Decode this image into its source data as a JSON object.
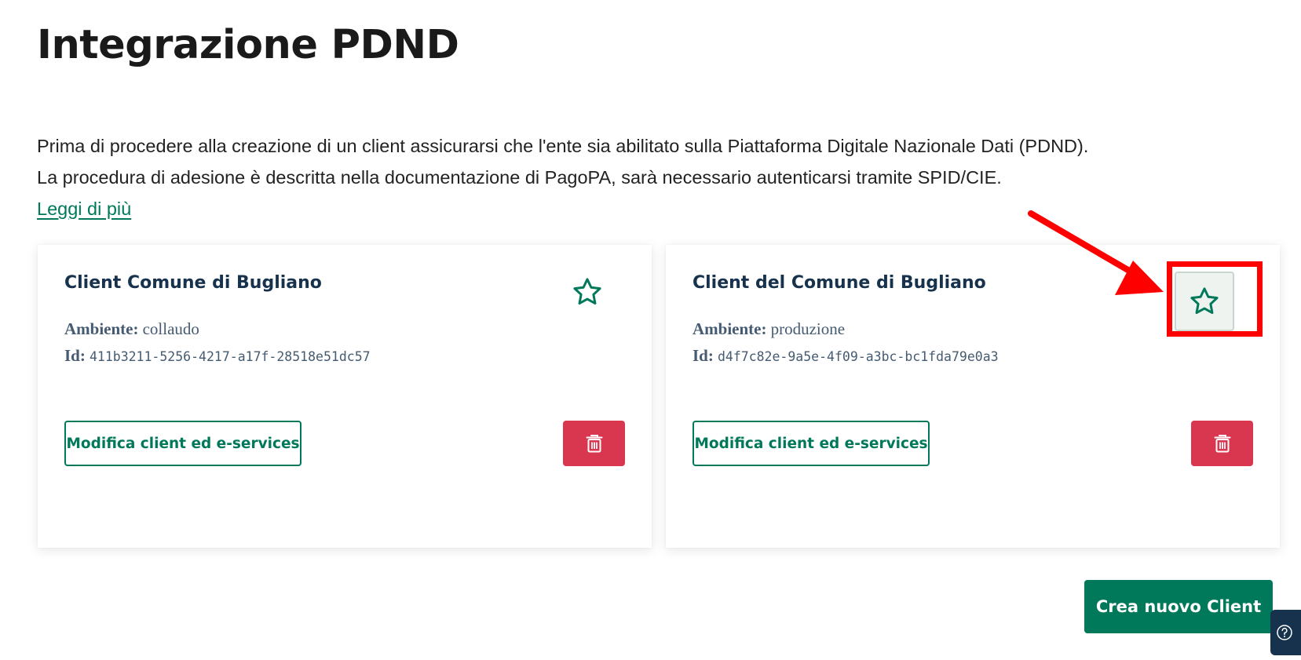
{
  "page": {
    "title": "Integrazione PDND",
    "intro_line_1": "Prima di procedere alla creazione di un client assicurarsi che l'ente sia abilitato sulla Piattaforma Digitale Nazionale Dati (PDND).",
    "intro_line_2": "La procedura di adesione è descritta nella documentazione di PagoPA, sarà necessario autenticarsi tramite SPID/CIE.",
    "read_more_link": "Leggi di più"
  },
  "clients": [
    {
      "title": "Client Comune di Bugliano",
      "env_label": "Ambiente:",
      "env_value": "collaudo",
      "id_label": "Id:",
      "id_value": "411b3211-5256-4217-a17f-28518e51dc57",
      "edit_label": "Modifica client ed e-services",
      "favorite_icon": "star-outline-icon",
      "delete_icon": "trash-icon"
    },
    {
      "title": "Client del Comune di Bugliano",
      "env_label": "Ambiente:",
      "env_value": "produzione",
      "id_label": "Id:",
      "id_value": "d4f7c82e-9a5e-4f09-a3bc-bc1fda79e0a3",
      "edit_label": "Modifica client ed e-services",
      "favorite_icon": "star-outline-icon",
      "delete_icon": "trash-icon"
    }
  ],
  "actions": {
    "create_label": "Crea nuovo Client",
    "help_icon": "help-icon"
  },
  "colors": {
    "primary": "#00785a",
    "danger": "#d9364f",
    "heading": "#17324d",
    "annotation": "#ff0000"
  }
}
